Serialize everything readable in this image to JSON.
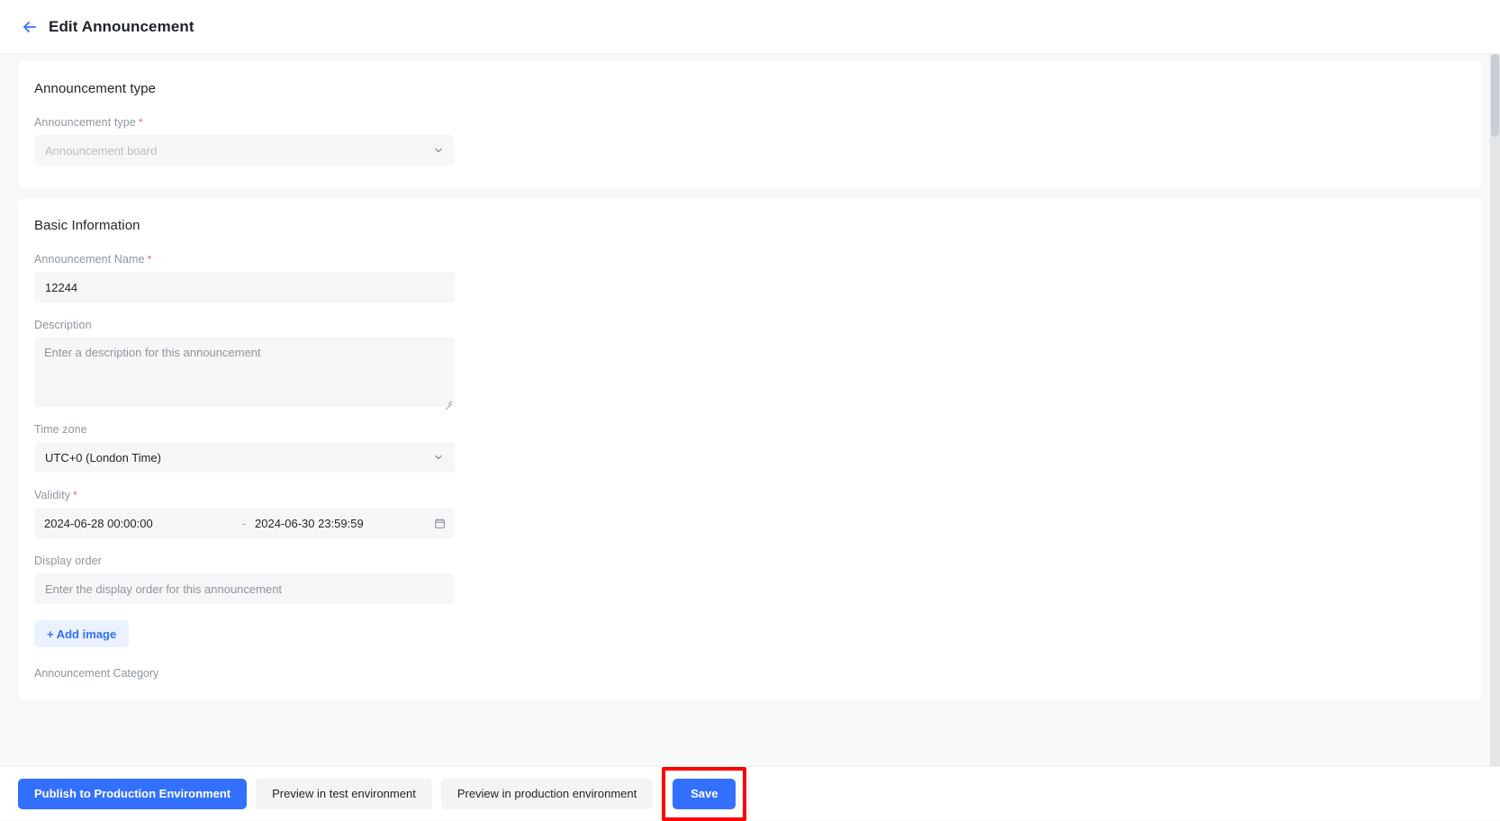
{
  "header": {
    "title": "Edit Announcement",
    "back_icon": "arrow-left-icon"
  },
  "sections": {
    "announcement_type": {
      "title": "Announcement type",
      "type_field": {
        "label": "Announcement type",
        "required": "*",
        "value": "Announcement board",
        "disabled": true,
        "icon": "chevron-down-icon"
      }
    },
    "basic_information": {
      "title": "Basic Information",
      "name_field": {
        "label": "Announcement Name",
        "required": "*",
        "value": "12244"
      },
      "description_field": {
        "label": "Description",
        "placeholder": "Enter a description for this announcement",
        "value": ""
      },
      "timezone_field": {
        "label": "Time zone",
        "value": "UTC+0 (London Time)",
        "icon": "chevron-down-icon"
      },
      "validity_field": {
        "label": "Validity",
        "required": "*",
        "start": "2024-06-28 00:00:00",
        "separator": "-",
        "end": "2024-06-30 23:59:59",
        "icon": "calendar-icon"
      },
      "display_order_field": {
        "label": "Display order",
        "placeholder": "Enter the display order for this announcement",
        "value": ""
      },
      "add_image_button": "+ Add image",
      "category_label": "Announcement Category"
    }
  },
  "footer": {
    "publish_label": "Publish to Production Environment",
    "preview_test_label": "Preview in test environment",
    "preview_prod_label": "Preview in production environment",
    "save_label": "Save"
  },
  "colors": {
    "primary": "#3370ff",
    "highlight": "#ff0000",
    "required": "#f76560",
    "page_bg": "#f7f8fa",
    "input_bg": "#f5f6f7"
  }
}
